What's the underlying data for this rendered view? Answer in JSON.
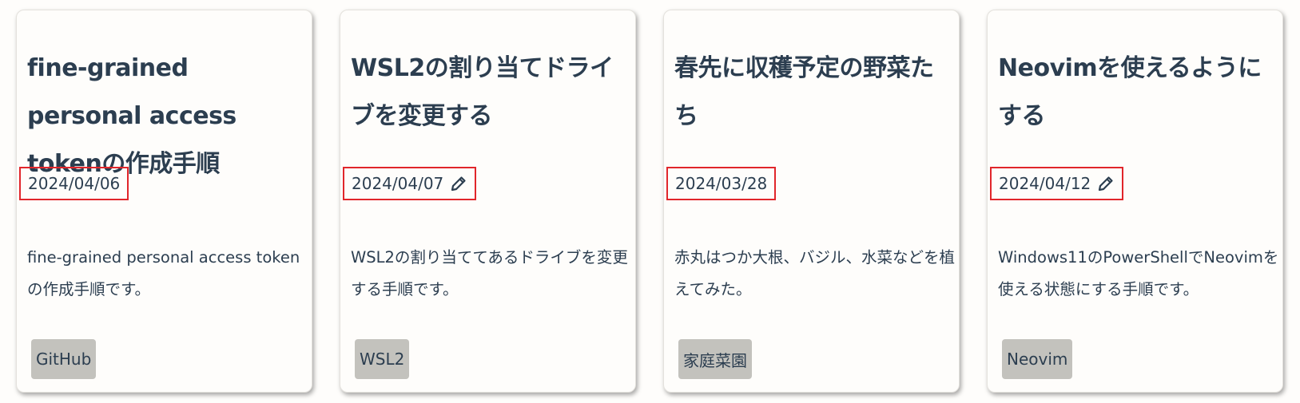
{
  "cards": [
    {
      "title": "fine-grained personal access tokenの作成手順",
      "date": "2024/04/06",
      "updated_icon": "",
      "description": "fine-grained personal access tokenの作成手順です。",
      "tag": "GitHub"
    },
    {
      "title": "WSL2の割り当てドライブを変更する",
      "date": "2024/04/07",
      "updated_icon": "pencil-icon",
      "description": "WSL2の割り当ててあるドライブを変更する手順です。",
      "tag": "WSL2"
    },
    {
      "title": "春先に収穫予定の野菜たち",
      "date": "2024/03/28",
      "updated_icon": "",
      "description": "赤丸はつか大根、バジル、水菜などを植えてみた。",
      "tag": "家庭菜園"
    },
    {
      "title": "Neovimを使えるようにする",
      "date": "2024/04/12",
      "updated_icon": "pencil-icon",
      "description": "Windows11のPowerShellでNeovimを使える状態にする手順です。",
      "tag": "Neovim"
    }
  ],
  "colors": {
    "text": "#2c3e50",
    "highlight_border": "#e1262b",
    "tag_background": "#c3c2bd",
    "page_background": "#fefdfb"
  }
}
